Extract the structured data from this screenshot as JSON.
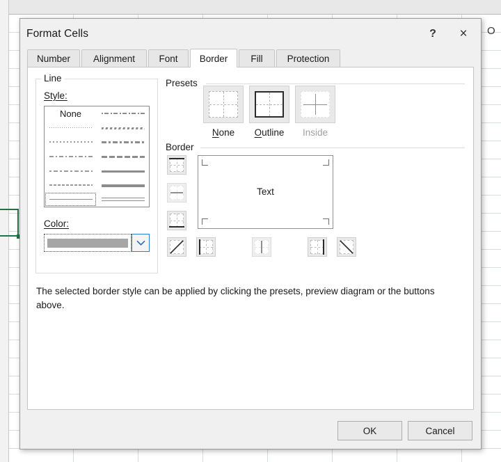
{
  "backdrop": {
    "cell_text": "O",
    "selection_label": "selected-cell"
  },
  "dialog": {
    "title": "Format Cells",
    "help_icon": "?",
    "close_icon": "×"
  },
  "tabs": [
    {
      "label": "Number",
      "active": false
    },
    {
      "label": "Alignment",
      "active": false
    },
    {
      "label": "Font",
      "active": false
    },
    {
      "label": "Border",
      "active": true
    },
    {
      "label": "Fill",
      "active": false
    },
    {
      "label": "Protection",
      "active": false
    }
  ],
  "line_group": {
    "legend": "Line",
    "style_label": "Style:",
    "none_label": "None",
    "color_label": "Color:",
    "color_value": "#a6a6a6",
    "selected_style_index": 13,
    "styles": [
      {
        "col": 1,
        "row": 1,
        "kind": "none"
      },
      {
        "col": 1,
        "row": 2,
        "kind": "hairline-dotted"
      },
      {
        "col": 1,
        "row": 3,
        "kind": "dotted"
      },
      {
        "col": 1,
        "row": 4,
        "kind": "dash-dot-light"
      },
      {
        "col": 1,
        "row": 5,
        "kind": "dash-dot-dot"
      },
      {
        "col": 1,
        "row": 6,
        "kind": "dashed-fine"
      },
      {
        "col": 1,
        "row": 7,
        "kind": "thin-solid"
      },
      {
        "col": 2,
        "row": 1,
        "kind": "dash-dot-medium"
      },
      {
        "col": 2,
        "row": 2,
        "kind": "slanted-dash"
      },
      {
        "col": 2,
        "row": 3,
        "kind": "medium-dash-dot"
      },
      {
        "col": 2,
        "row": 4,
        "kind": "medium-dashed"
      },
      {
        "col": 2,
        "row": 5,
        "kind": "medium-solid"
      },
      {
        "col": 2,
        "row": 6,
        "kind": "thick-solid"
      },
      {
        "col": 2,
        "row": 7,
        "kind": "double-line"
      }
    ]
  },
  "presets": {
    "legend": "Presets",
    "items": [
      {
        "label": "None",
        "name": "preset-none",
        "disabled": false,
        "accel": "N"
      },
      {
        "label": "Outline",
        "name": "preset-outline",
        "disabled": false,
        "accel": "O"
      },
      {
        "label": "Inside",
        "name": "preset-inside",
        "disabled": true,
        "accel": ""
      }
    ]
  },
  "border_section": {
    "legend": "Border",
    "preview_text": "Text",
    "buttons": [
      {
        "name": "border-top-button",
        "disabled": false
      },
      {
        "name": "border-horizontal-inside-button",
        "disabled": true
      },
      {
        "name": "border-bottom-button",
        "disabled": false
      },
      {
        "name": "border-diagonal-up-button",
        "disabled": false
      },
      {
        "name": "border-left-button",
        "disabled": false
      },
      {
        "name": "border-vertical-inside-button",
        "disabled": true
      },
      {
        "name": "border-right-button",
        "disabled": false
      },
      {
        "name": "border-diagonal-down-button",
        "disabled": false
      }
    ]
  },
  "description": "The selected border style can be applied by clicking the presets, preview diagram or the buttons above.",
  "footer": {
    "ok_label": "OK",
    "cancel_label": "Cancel"
  }
}
